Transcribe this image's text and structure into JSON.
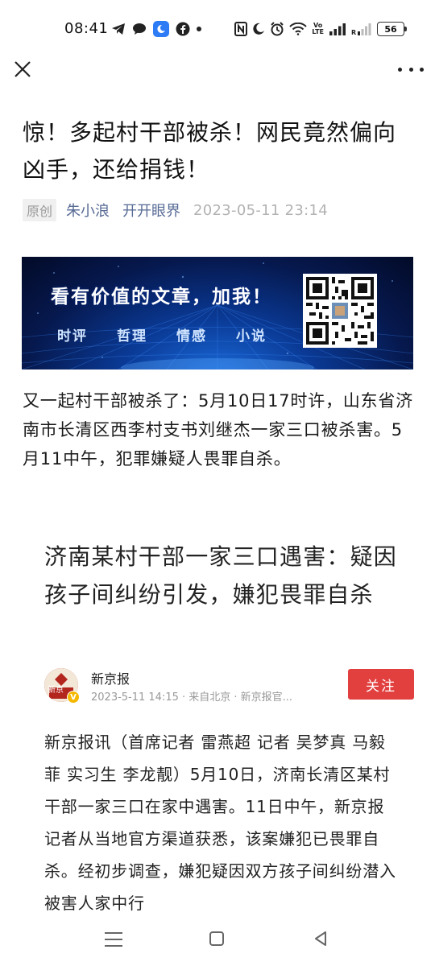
{
  "status_bar": {
    "time": "08:41",
    "battery": "56",
    "volte_line1": "Vo",
    "volte_line2": "LTE",
    "icons": [
      "telegram-icon",
      "chat-icon",
      "app-icon",
      "facebook-icon",
      "dot-icon",
      "nfc-icon",
      "moon-icon",
      "alarm-icon",
      "wifi-icon",
      "volte-icon",
      "signal-icon",
      "roaming-signal-icon",
      "battery-icon"
    ]
  },
  "nav": {
    "close_icon": "close-icon",
    "more_icon": "more-icon"
  },
  "article": {
    "title": "惊！多起村干部被杀！网民竟然偏向凶手，还给捐钱！",
    "original_tag": "原创",
    "author": "朱小浪",
    "account": "开开眼界",
    "date": "2023-05-11 23:14",
    "paragraph": "又一起村干部被杀了：5月10日17时许，山东省济南市长清区西李村支书刘继杰一家三口被杀害。5月11中午，犯罪嫌疑人畏罪自杀。"
  },
  "banner": {
    "headline": "看有价值的文章，加我！",
    "tags": [
      "时评",
      "哲理",
      "情感",
      "小说"
    ]
  },
  "embed": {
    "title": "济南某村干部一家三口遇害：疑因孩子间纠纷引发，嫌犯畏罪自杀",
    "source": "新京报",
    "avatar_text": "新京",
    "subline": "2023-5-11 14:15 · 来自北京 · 新京报官...",
    "follow_label": "关注",
    "body": "新京报讯（首席记者 雷燕超 记者 吴梦真 马毅菲 实习生 李龙靓）5月10日，济南长清区某村干部一家三口在家中遇害。11日中午，新京报记者从当地官方渠道获悉，该案嫌犯已畏罪自杀。经初步调查，嫌犯疑因双方孩子间纠纷潜入被害人家中行"
  },
  "colors": {
    "link_blue": "#576b95",
    "follow_red": "#e23f3f",
    "banner_blue": "#0a3a96"
  }
}
